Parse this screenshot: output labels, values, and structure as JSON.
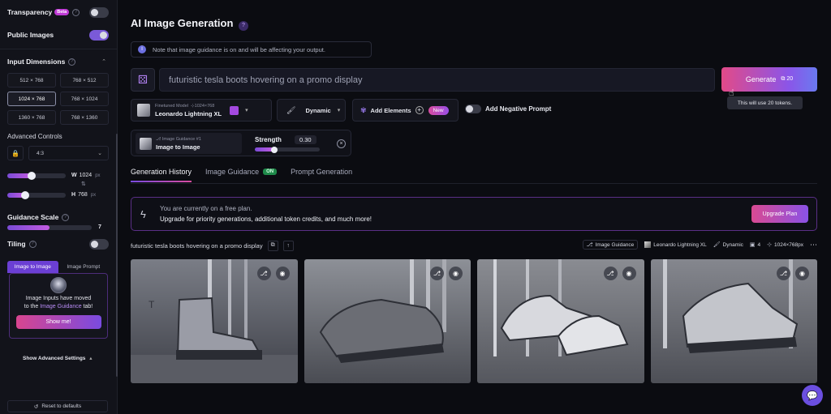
{
  "sidebar": {
    "transparency_label": "Transparency",
    "beta_badge": "Beta",
    "public_images_label": "Public Images",
    "input_dimensions_label": "Input Dimensions",
    "dimensions": [
      "512 × 768",
      "768 × 512",
      "1024 × 768",
      "768 × 1024",
      "1360 × 768",
      "768 × 1360"
    ],
    "selected_dimension": "1024 × 768",
    "advanced_controls_label": "Advanced Controls",
    "aspect_ratio": "4:3",
    "width_label": "W",
    "width_value": "1024",
    "height_label": "H",
    "height_value": "768",
    "unit": "px",
    "width_slider_fraction": 0.42,
    "height_slider_fraction": 0.3,
    "guidance_scale_label": "Guidance Scale",
    "guidance_scale_value": "7",
    "guidance_slider_fraction": 0.5,
    "tiling_label": "Tiling",
    "tab_image_to_image": "Image to Image",
    "tab_image_prompt": "Image Prompt",
    "notice_line1": "Image Inputs have moved",
    "notice_line2_prefix": "to the ",
    "notice_line2_link": "Image Guidance",
    "notice_line2_suffix": " tab!",
    "show_me_label": "Show me!",
    "show_advanced_label": "Show Advanced Settings",
    "reset_label": "Reset to defaults"
  },
  "header": {
    "title": "AI Image Generation",
    "info_note": "Note that image guidance is on and will be affecting your output."
  },
  "prompt": {
    "value": "futuristic tesla boots hovering on a promo display"
  },
  "generate": {
    "label": "Generate",
    "tokens": "20",
    "tooltip": "This will use 20 tokens."
  },
  "model": {
    "caption": "Finetuned Model",
    "resolution": "1024×768",
    "name": "Leonardo Lightning XL"
  },
  "style": {
    "label": "Dynamic"
  },
  "elements": {
    "label": "Add Elements",
    "new_badge": "New"
  },
  "negative_prompt": {
    "label": "Add Negative Prompt"
  },
  "image_guidance": {
    "caption": "Image Guidance #1",
    "type": "Image to Image",
    "strength_label": "Strength",
    "strength_value": "0.30",
    "strength_fraction": 0.3
  },
  "tabs": {
    "history": "Generation History",
    "guidance": "Image Guidance",
    "guidance_badge": "ON",
    "prompt_gen": "Prompt Generation"
  },
  "plan_banner": {
    "line1": "You are currently on a free plan.",
    "line2": "Upgrade for priority generations, additional token credits, and much more!",
    "button": "Upgrade Plan"
  },
  "generation": {
    "prompt": "futuristic tesla boots hovering on a promo display",
    "meta_guidance": "Image Guidance",
    "meta_model": "Leonardo Lightning XL",
    "meta_style": "Dynamic",
    "meta_count": "4",
    "meta_size": "1024×768px"
  },
  "gallery": [
    "Tesla boot 1",
    "Tesla boot 2",
    "Tesla boot 3",
    "Tesla boot 4"
  ]
}
